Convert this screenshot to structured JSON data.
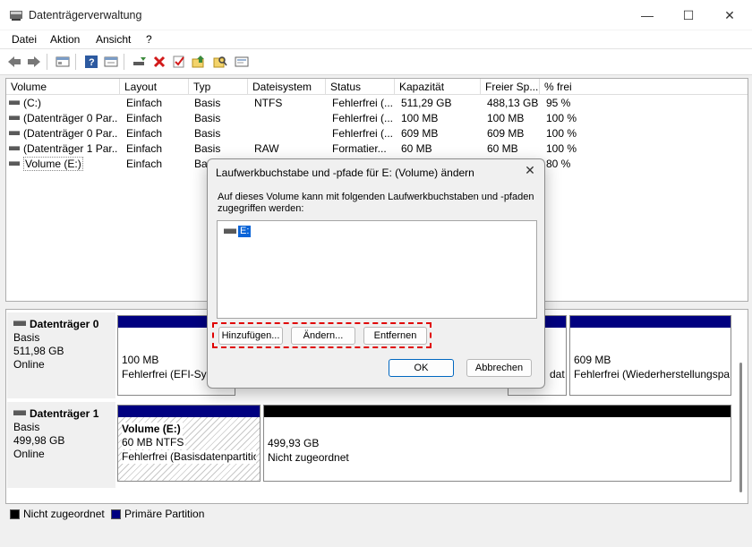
{
  "window": {
    "title": "Datenträgerverwaltung",
    "controls": {
      "minimize": "—",
      "maximize": "☐",
      "close": "✕"
    }
  },
  "menu": [
    "Datei",
    "Aktion",
    "Ansicht",
    "?"
  ],
  "toolbar": {
    "icons": [
      "back-icon",
      "forward-icon",
      "properties-icon",
      "help-icon",
      "view-icon",
      "connect-icon",
      "delete-icon",
      "check-icon",
      "import-icon",
      "search-icon",
      "settings-icon"
    ]
  },
  "table": {
    "columns": [
      "Volume",
      "Layout",
      "Typ",
      "Dateisystem",
      "Status",
      "Kapazität",
      "Freier Sp...",
      "% frei"
    ],
    "rows": [
      [
        "(C:)",
        "Einfach",
        "Basis",
        "NTFS",
        "Fehlerfrei (...",
        "511,29 GB",
        "488,13 GB",
        "95 %"
      ],
      [
        "(Datenträger 0 Par...",
        "Einfach",
        "Basis",
        "",
        "Fehlerfrei (...",
        "100 MB",
        "100 MB",
        "100 %"
      ],
      [
        "(Datenträger 0 Par...",
        "Einfach",
        "Basis",
        "",
        "Fehlerfrei (...",
        "609 MB",
        "609 MB",
        "100 %"
      ],
      [
        "(Datenträger 1 Par...",
        "Einfach",
        "Basis",
        "RAW",
        "Formatier...",
        "60 MB",
        "60 MB",
        "100 %"
      ],
      [
        "Volume (E:)",
        "Einfach",
        "Basis",
        "",
        "",
        "",
        "",
        "80 %"
      ]
    ]
  },
  "disks": [
    {
      "name": "Datenträger 0",
      "type": "Basis",
      "size": "511,98 GB",
      "state": "Online",
      "partitions": [
        {
          "line1": "100 MB",
          "line2": "Fehlerfrei (EFI-Sys"
        },
        {
          "line1": "",
          "line2": "dat"
        },
        {
          "line1": "609 MB",
          "line2": "Fehlerfrei (Wiederherstellungspa"
        }
      ]
    },
    {
      "name": "Datenträger 1",
      "type": "Basis",
      "size": "499,98 GB",
      "state": "Online",
      "partitions": [
        {
          "title": "Volume  (E:)",
          "line1": "60 MB NTFS",
          "line2": "Fehlerfrei (Basisdatenpartitio"
        },
        {
          "line1": "499,93 GB",
          "line2": "Nicht zugeordnet"
        }
      ]
    }
  ],
  "legend": [
    {
      "label": "Nicht zugeordnet",
      "color": "#000000"
    },
    {
      "label": "Primäre Partition",
      "color": "#000080"
    }
  ],
  "dialog": {
    "title": "Laufwerkbuchstabe und -pfade für E: (Volume) ändern",
    "close": "✕",
    "description": "Auf dieses Volume kann mit folgenden Laufwerkbuchstaben und -pfaden zugegriffen werden:",
    "drive_item": "E:",
    "buttons": {
      "add": "Hinzufügen...",
      "change": "Ändern...",
      "remove": "Entfernen",
      "ok": "OK",
      "cancel": "Abbrechen"
    }
  },
  "colors": {
    "primary_partition": "#000080",
    "unallocated": "#000000",
    "highlight": "#e00000",
    "selection": "#0a64d8"
  }
}
